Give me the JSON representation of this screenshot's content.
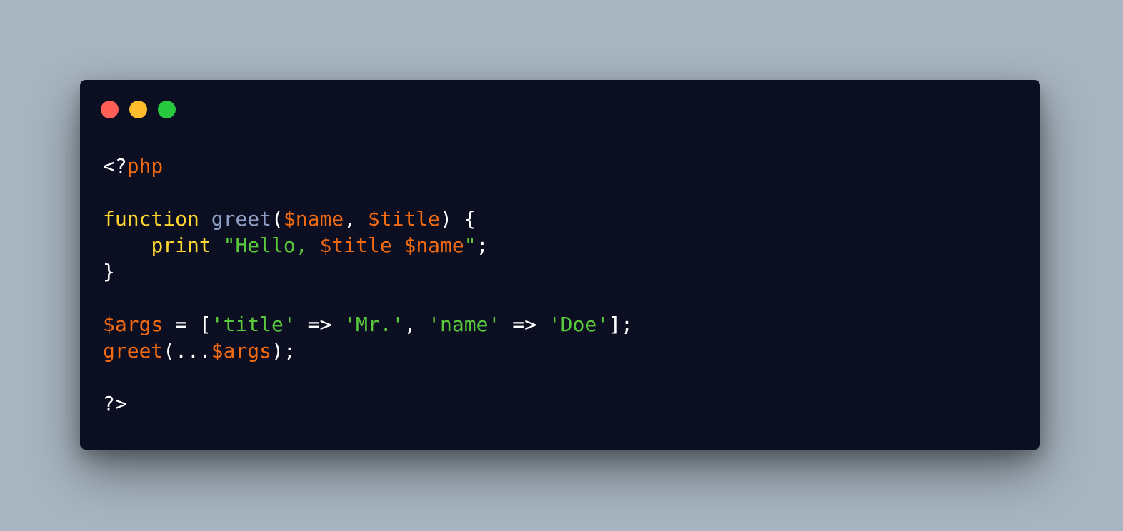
{
  "window": {
    "traffic_lights": [
      {
        "name": "close-dot",
        "color": "#ff5f56"
      },
      {
        "name": "minimize-dot",
        "color": "#ffbd2e"
      },
      {
        "name": "maximize-dot",
        "color": "#27c93f"
      }
    ]
  },
  "colors": {
    "background": "#a8b5c1",
    "window": "#0c0f21",
    "keyword": "#ffd630",
    "function_name": "#8ea0c7",
    "variable": "#f26a12",
    "string": "#5ac93b",
    "plain": "#ffffff"
  },
  "code": {
    "lines": [
      [
        {
          "t": "plain",
          "v": "<?"
        },
        {
          "t": "var",
          "v": "php"
        }
      ],
      [],
      [
        {
          "t": "keyword",
          "v": "function"
        },
        {
          "t": "plain",
          "v": " "
        },
        {
          "t": "func",
          "v": "greet"
        },
        {
          "t": "plain",
          "v": "("
        },
        {
          "t": "var",
          "v": "$name"
        },
        {
          "t": "plain",
          "v": ", "
        },
        {
          "t": "var",
          "v": "$title"
        },
        {
          "t": "plain",
          "v": ") {"
        }
      ],
      [
        {
          "t": "plain",
          "v": "    "
        },
        {
          "t": "keyword",
          "v": "print"
        },
        {
          "t": "plain",
          "v": " "
        },
        {
          "t": "string",
          "v": "\"Hello, "
        },
        {
          "t": "var",
          "v": "$title"
        },
        {
          "t": "plain",
          "v": " "
        },
        {
          "t": "var",
          "v": "$name"
        },
        {
          "t": "string",
          "v": "\""
        },
        {
          "t": "plain",
          "v": ";"
        }
      ],
      [
        {
          "t": "plain",
          "v": "}"
        }
      ],
      [],
      [
        {
          "t": "var",
          "v": "$args"
        },
        {
          "t": "plain",
          "v": " = ["
        },
        {
          "t": "string",
          "v": "'title'"
        },
        {
          "t": "plain",
          "v": " => "
        },
        {
          "t": "string",
          "v": "'Mr.'"
        },
        {
          "t": "plain",
          "v": ", "
        },
        {
          "t": "string",
          "v": "'name'"
        },
        {
          "t": "plain",
          "v": " => "
        },
        {
          "t": "string",
          "v": "'Doe'"
        },
        {
          "t": "plain",
          "v": "];"
        }
      ],
      [
        {
          "t": "var",
          "v": "greet"
        },
        {
          "t": "plain",
          "v": "(..."
        },
        {
          "t": "var",
          "v": "$args"
        },
        {
          "t": "plain",
          "v": ");"
        }
      ],
      [],
      [
        {
          "t": "plain",
          "v": "?>"
        }
      ]
    ]
  }
}
